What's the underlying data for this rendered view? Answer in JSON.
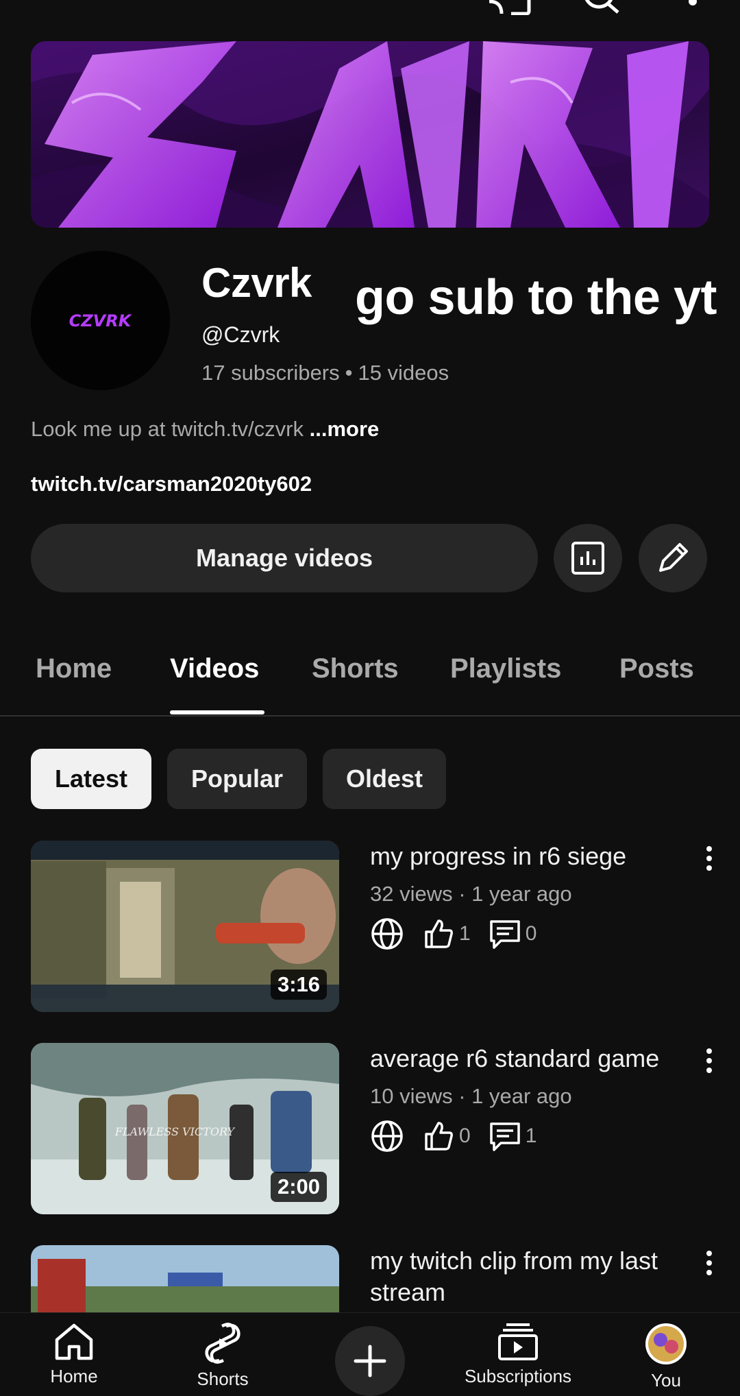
{
  "channel": {
    "name": "Czvrk",
    "handle": "@Czvrk",
    "subscribers": "17 subscribers",
    "separator": "•",
    "videos": "15 videos",
    "description": "Look me up at twitch.tv/czvrk",
    "more": "...more",
    "link": "twitch.tv/carsman2020ty602",
    "avatar_text": "CZVRK",
    "banner_text": "ZAVRI"
  },
  "overlay_caption": "go sub to the yt",
  "actions": {
    "manage_videos": "Manage videos"
  },
  "tabs": [
    {
      "label": "Home"
    },
    {
      "label": "Videos",
      "active": true
    },
    {
      "label": "Shorts"
    },
    {
      "label": "Playlists"
    },
    {
      "label": "Posts"
    }
  ],
  "chips": [
    {
      "label": "Latest",
      "selected": true
    },
    {
      "label": "Popular"
    },
    {
      "label": "Oldest"
    }
  ],
  "videos": [
    {
      "title": "my progress in r6 siege",
      "meta": "32 views · 1 year ago",
      "duration": "3:16",
      "likes": "1",
      "comments": "0"
    },
    {
      "title": "average r6 standard game",
      "meta": "10 views · 1 year ago",
      "duration": "2:00",
      "likes": "0",
      "comments": "1",
      "thumb_text": "FLAWLESS VICTORY"
    },
    {
      "title": "my twitch clip from my last stream"
    }
  ],
  "bottom_nav": {
    "home": "Home",
    "shorts": "Shorts",
    "subscriptions": "Subscriptions",
    "you": "You"
  },
  "colors": {
    "background": "#0f0f0f",
    "surface": "#272727",
    "secondary_text": "#aaaaaa",
    "accent_purple": "#b53cff"
  }
}
